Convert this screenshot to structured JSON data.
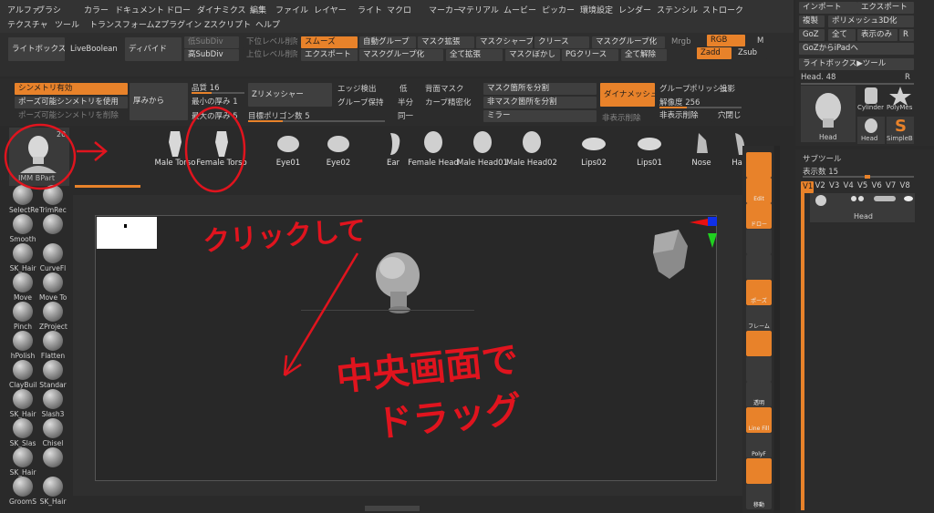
{
  "menu": {
    "row1": [
      "アルファ",
      "ブラシ",
      "カラー",
      "ドキュメント",
      "ドロー",
      "ダイナミクス",
      "編集",
      "ファイル",
      "レイヤー",
      "ライト",
      "マクロ",
      "マーカー",
      "マテリアル",
      "ムービー",
      "ピッカー",
      "環境設定",
      "レンダー",
      "ステンシル",
      "ストローク"
    ],
    "row2": [
      "テクスチャ",
      "ツール",
      "トランスフォーム",
      "Zプラグイン",
      "Zスクリプト",
      "ヘルプ"
    ]
  },
  "toolbar": {
    "lightbox": "ライトボックス",
    "liveboolean": "LiveBoolean",
    "divide": "ディバイド",
    "lowsubdiv": "低SubDiv",
    "highsubdiv": "高SubDiv",
    "lower_level": "下位レベル削除",
    "higher_level": "上位レベル削除",
    "smooth": "スムーズ",
    "export": "エクスポート",
    "autogroup": "自動グループ",
    "maskgroup": "マスクグループ化",
    "maskexpand": "マスク拡張",
    "expandall": "全て拡張",
    "masksharp": "マスクシャープ",
    "maskblur": "マスクぼかし",
    "crease": "クリース",
    "pgcrease": "PGクリース",
    "maskgroupize": "マスクグループ化",
    "uncreaseall": "全て解除",
    "mrgb": "Mrgb",
    "rgb": "RGB",
    "m": "M",
    "zadd": "Zadd",
    "zsub": "Zsub"
  },
  "left_toolbar": {
    "symmetry_on": "シンメトリ有効",
    "pose_symmetry": "ポーズ可能シンメトリを使用",
    "delete_symmetry": "ポーズ可能シンメトリを削除",
    "from_thickness": "厚みから",
    "quality_label": "品質 16",
    "min_thickness": "最小の厚み 1",
    "max_thickness": "最大の厚み 5",
    "zremesher": "Zリメッシャー",
    "target_polygons": "目標ポリゴン数 5",
    "edge_detect": "エッジ検出",
    "keep_groups": "グループ保持",
    "low": "低",
    "half": "半分",
    "same": "同一",
    "back_mask": "背面マスク",
    "curve_accuracy": "カーブ精密化",
    "split_mask": "マスク箇所を分割",
    "split_unmask": "非マスク箇所を分割",
    "mirror": "ミラー",
    "dynamesh": "ダイナメッシュ",
    "group": "グループ",
    "polish": "ポリッシュ",
    "project": "投影",
    "resolution": "解像度 256",
    "hide": "非表示削除",
    "close_holes": "穴閉じ",
    "del_hidden": "非表示削除"
  },
  "current_tool": {
    "label": "IMM BPart",
    "count": "20"
  },
  "project_items": [
    "Male Torso",
    "Female Torso",
    "Eye01",
    "Eye02",
    "Ear",
    "Female Head",
    "Male Head01",
    "Male Head02",
    "Lips02",
    "Lips01",
    "Nose",
    "Hair"
  ],
  "brushes": [
    {
      "name": "SelectRe"
    },
    {
      "name": "TrimRec"
    },
    {
      "name": "Smooth"
    },
    {
      "name": ""
    },
    {
      "name": "SK_Hair"
    },
    {
      "name": "CurveFl"
    },
    {
      "name": "Move"
    },
    {
      "name": "Move To"
    },
    {
      "name": "Pinch"
    },
    {
      "name": "ZProject"
    },
    {
      "name": "hPolish"
    },
    {
      "name": "Flatten"
    },
    {
      "name": "ClayBuil"
    },
    {
      "name": "Standar"
    },
    {
      "name": "SK_Hair"
    },
    {
      "name": "Slash3"
    },
    {
      "name": "SK_Slas"
    },
    {
      "name": "Chisel"
    },
    {
      "name": "SK_Hair"
    },
    {
      "name": ""
    },
    {
      "name": "GroomS"
    },
    {
      "name": "SK_Hair"
    }
  ],
  "right_panel": {
    "import": "インポート",
    "export": "エクスポート",
    "clone": "複製",
    "polymesh3d": "ポリメッシュ3D化",
    "goz": "GoZ",
    "all": "全て",
    "visible": "表示のみ",
    "r": "R",
    "goz_ipad": "GoZからiPadへ",
    "lightbox_tool": "ライトボックス▶ツール",
    "head_label": "Head. 48",
    "r2": "R",
    "thumbs": [
      "Head",
      "Cylinder",
      "PolyMes",
      "Head",
      "SimpleB"
    ],
    "subtool_title": "サブツール",
    "display_count": "表示数 15",
    "versions": [
      "V1",
      "V2",
      "V3",
      "V4",
      "V5",
      "V6",
      "V7",
      "V8"
    ],
    "subtool_name": "Head"
  },
  "right_shelf": [
    "",
    "Edit",
    "ドロー",
    "",
    "",
    "ポーズ",
    "フレーム",
    "",
    "",
    "透明",
    "Line Fill",
    "PolyF",
    "",
    "移動"
  ],
  "annotations": {
    "click": "クリックして",
    "center": "中央画面で",
    "drag": "ドラッグ"
  },
  "colors": {
    "accent": "#e8822a",
    "annotation": "#e0141e",
    "bg": "#2a2a2a"
  }
}
